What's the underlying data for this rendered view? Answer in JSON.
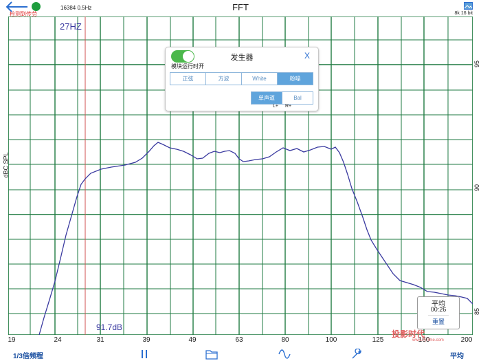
{
  "top": {
    "subtitle": "检测到传劳",
    "fft_info": "16384  0.5Hz",
    "title": "FFT",
    "resolution": "8k 16 bit"
  },
  "plot": {
    "ylabel": "dBC SPL",
    "yticks": [
      "95",
      "90",
      "85"
    ],
    "xticks": [
      "19",
      "24",
      "31",
      "39",
      "49",
      "63",
      "80",
      "100",
      "125",
      "160",
      "200"
    ],
    "cursor_label": "27HZ",
    "db_label": "91.7dB",
    "grid_color": "#1e7a40",
    "curve_color": "#3a3aa0"
  },
  "generator": {
    "title": "发生器",
    "close": "X",
    "sub": "模块运行时开",
    "waveforms": [
      "正弦",
      "方波",
      "White",
      "粉噪"
    ],
    "selected_waveform": "粉噪",
    "channels": [
      "单声道",
      "Bal"
    ],
    "selected_channel": "单声道",
    "lr": [
      "L+",
      "R+"
    ]
  },
  "avg_box": {
    "label": "平均",
    "time": "00:26",
    "reset": "重置"
  },
  "toolbar": {
    "left_label": "1/3倍频程",
    "right_label": "平均"
  },
  "watermark": {
    "main": "投影时代",
    "sub": "www.PjTime.com"
  }
}
